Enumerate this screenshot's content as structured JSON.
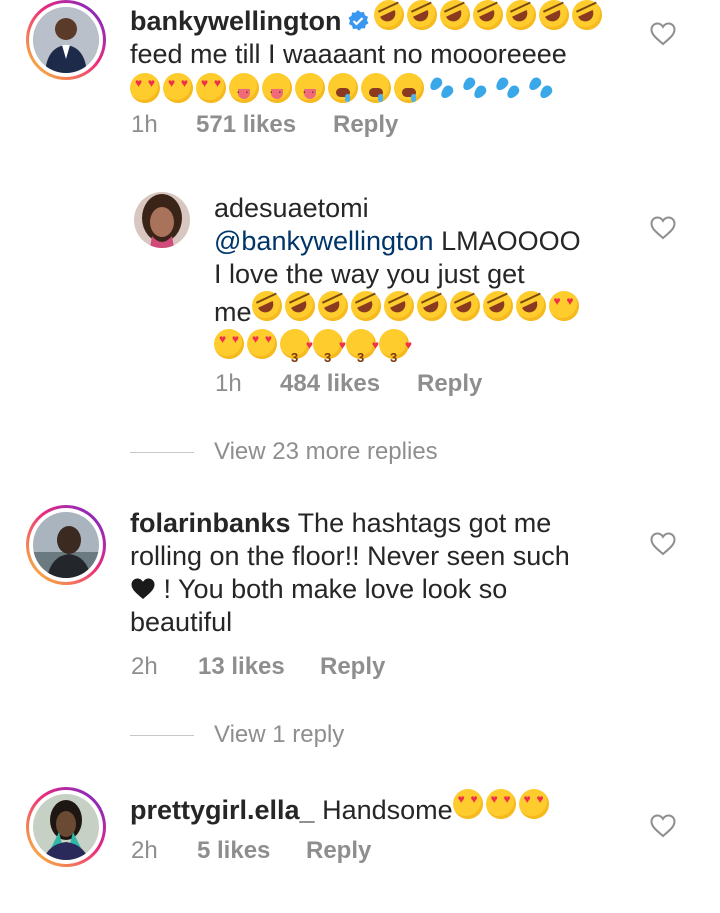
{
  "comments": [
    {
      "username": "bankywellington",
      "verified": true,
      "text": "feed me till I waaaant no moooreeee",
      "emoji_after_name": [
        "rofl-emoji",
        "rofl-emoji",
        "rofl-emoji",
        "rofl-emoji",
        "rofl-emoji",
        "rofl-emoji",
        "rofl-emoji"
      ],
      "emoji_after_text": [
        "heart-eyes-emoji",
        "heart-eyes-emoji",
        "heart-eyes-emoji",
        "tongue-emoji",
        "tongue-emoji",
        "tongue-emoji",
        "drool-emoji",
        "drool-emoji",
        "drool-emoji",
        "sweat-drops-emoji",
        "sweat-drops-emoji",
        "sweat-drops-emoji",
        "sweat-drops-emoji"
      ],
      "time": "1h",
      "likes": "571 likes",
      "reply": "Reply"
    },
    {
      "username": "adesuaetomi",
      "mention": "@bankywellington",
      "text_line1": "LMAOOOO",
      "text_line2": "I love the way you just get",
      "text_line3": "me",
      "emoji": [
        "rofl-emoji",
        "rofl-emoji",
        "rofl-emoji",
        "rofl-emoji",
        "rofl-emoji",
        "rofl-emoji",
        "rofl-emoji",
        "rofl-emoji",
        "rofl-emoji",
        "heart-eyes-emoji",
        "heart-eyes-emoji",
        "heart-eyes-emoji",
        "kiss-emoji",
        "kiss-emoji",
        "kiss-emoji",
        "kiss-emoji"
      ],
      "time": "1h",
      "likes": "484 likes",
      "reply": "Reply"
    },
    {
      "username": "folarinbanks",
      "text_line1": "The hashtags got me",
      "text_line2": "rolling on the floor!! Never seen such",
      "text_line3": "! You both make love look so",
      "text_line4": "beautiful",
      "time": "2h",
      "likes": "13 likes",
      "reply": "Reply"
    },
    {
      "username": "prettygirl.ella_",
      "text": "Handsome",
      "emoji": [
        "heart-eyes-emoji",
        "heart-eyes-emoji",
        "heart-eyes-emoji"
      ],
      "time": "2h",
      "likes": "5 likes",
      "reply": "Reply"
    }
  ],
  "view_replies_1": "View 23 more replies",
  "view_replies_2": "View 1 reply",
  "colors": {
    "text": "#262626",
    "meta": "#8e8e8e",
    "mention": "#003569",
    "story_ring_start": "#f9ce34",
    "story_ring_mid": "#ee2a7b",
    "story_ring_end": "#6228d7",
    "verified_blue": "#3897f0"
  },
  "icons": [
    "like-heart-icon",
    "verified-badge-icon",
    "black-heart-emoji"
  ]
}
